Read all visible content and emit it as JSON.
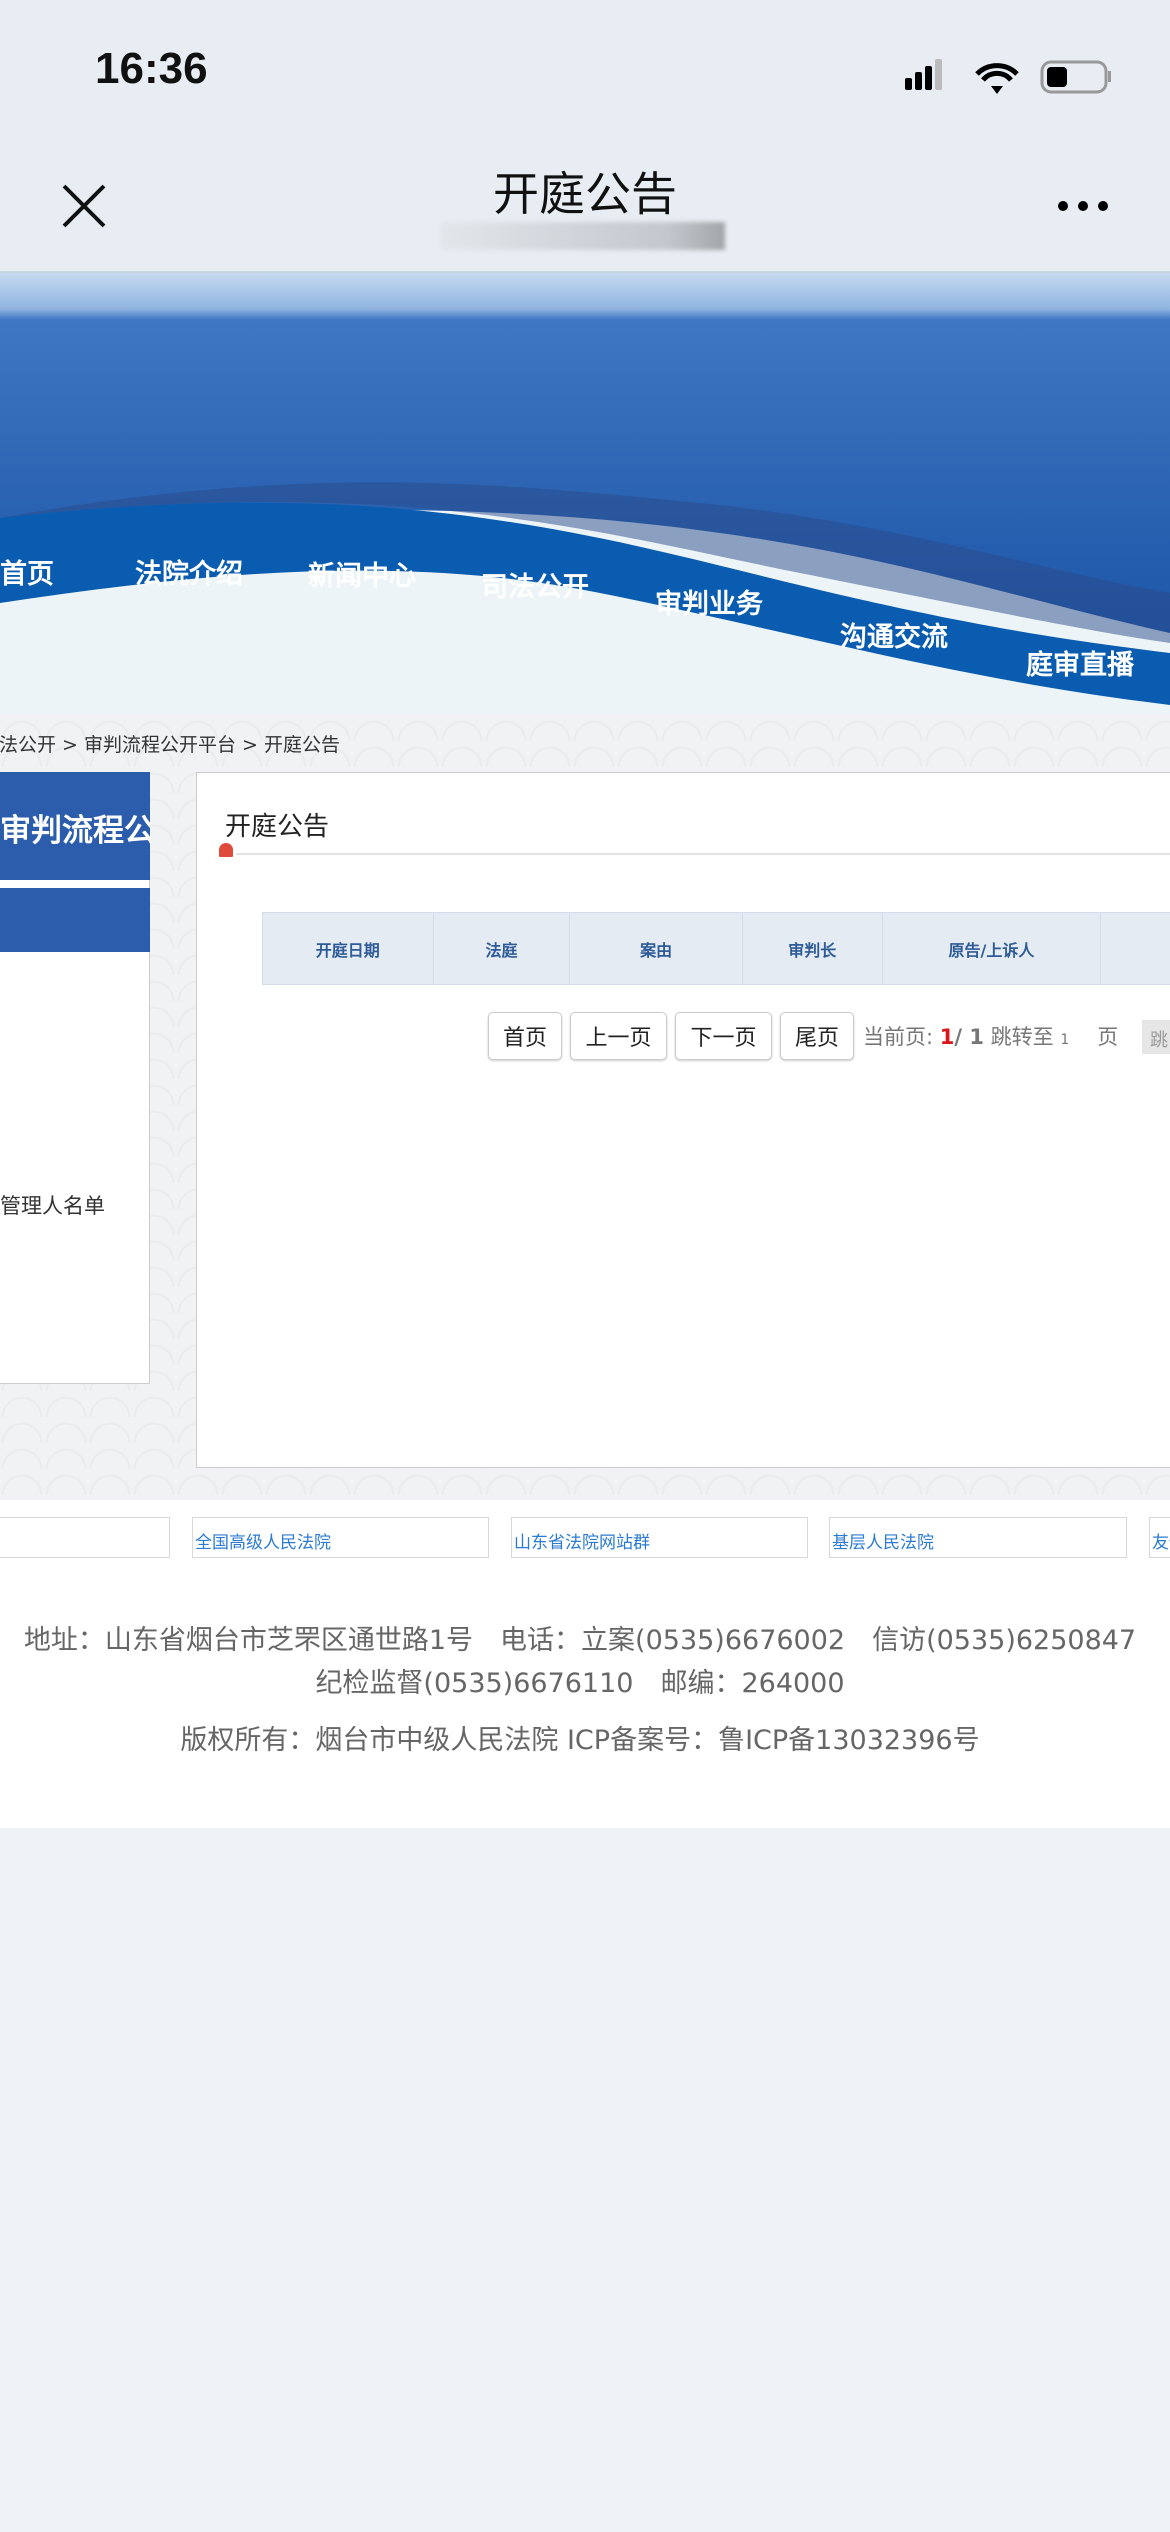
{
  "status_bar": {
    "time": "16:36"
  },
  "nav_bar": {
    "title": "开庭公告"
  },
  "site_nav": {
    "items": [
      "首页",
      "法院介绍",
      "新闻中心",
      "司法公开",
      "审判业务",
      "沟通交流",
      "庭审直播"
    ]
  },
  "breadcrumb": "司法公开 > 审判流程公开平台 > 开庭公告",
  "sidebar": {
    "header": "审判流程公开平台",
    "item": "破产管理人名单"
  },
  "main": {
    "title": "开庭公告",
    "columns": [
      "开庭日期",
      "法庭",
      "案由",
      "审判长",
      "原告/上诉人",
      ""
    ]
  },
  "pager": {
    "first": "首页",
    "prev": "上一页",
    "next": "下一页",
    "last": "尾页",
    "current_label": "当前页: ",
    "current": "1",
    "total": "/ 1",
    "jump_label": " 跳转至 ",
    "jump_value": "1",
    "page_unit": "页",
    "jump_button": "跳"
  },
  "links": [
    "",
    "全国高级人民法院",
    "山东省法院网站群",
    "基层人民法院",
    "友情链接"
  ],
  "footer": {
    "line1": "地址：山东省烟台市芝罘区通世路1号　电话：立案(0535)6676002　信访(0535)6250847",
    "line2": "纪检监督(0535)6676110　邮编：264000",
    "line3": "版权所有：烟台市中级人民法院 ICP备案号：鲁ICP备13032396号"
  },
  "colors": {
    "brand_blue": "#0a5cb0",
    "sidebar_blue": "#2b5dac",
    "link": "#2b7bd2",
    "red": "#d8161b"
  }
}
